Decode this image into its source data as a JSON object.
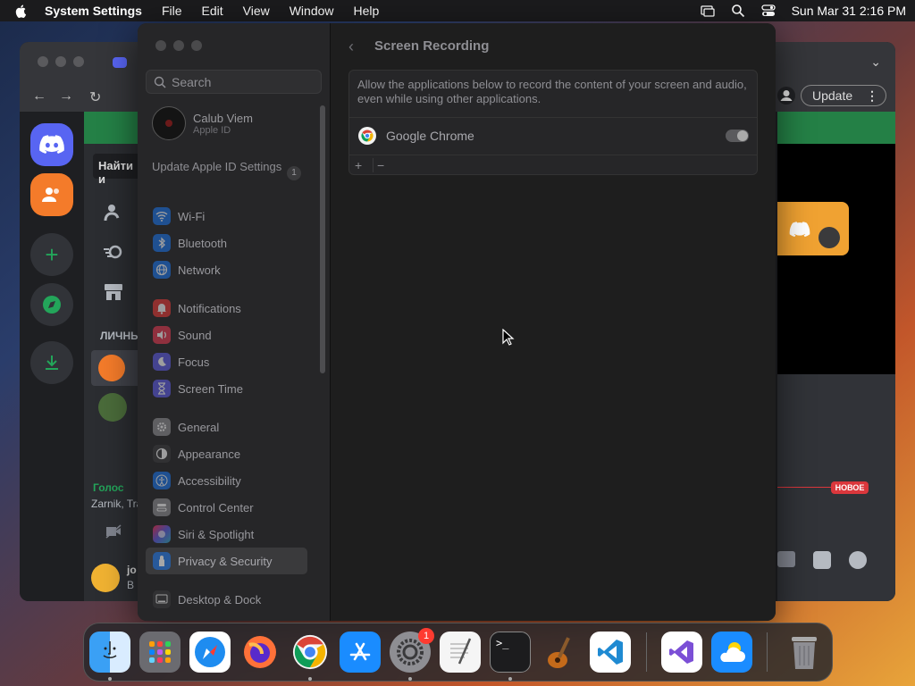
{
  "menubar": {
    "app": "System Settings",
    "items": [
      "File",
      "Edit",
      "View",
      "Window",
      "Help"
    ],
    "datetime": "Sun Mar 31  2:16 PM"
  },
  "chrome": {
    "update_label": "Update"
  },
  "discord": {
    "find_label": "Найти и",
    "section_label": "ЛИЧНЫ",
    "voice_label": "Голос",
    "voice_sub": "Zarnik, Tra",
    "user_label": "jo",
    "user_sub": "В",
    "new_badge": "НОВОЕ"
  },
  "settings": {
    "search_placeholder": "Search",
    "account": {
      "name": "Calub Viem",
      "sub": "Apple ID"
    },
    "update_apple_id": "Update Apple ID Settings",
    "update_badge": "1",
    "sidebar": [
      {
        "label": "Wi-Fi",
        "icon": "wifi-icon",
        "color": "#1a73e8"
      },
      {
        "label": "Bluetooth",
        "icon": "bluetooth-icon",
        "color": "#1a73e8"
      },
      {
        "label": "Network",
        "icon": "network-icon",
        "color": "#1a73e8"
      },
      {
        "label": "Notifications",
        "icon": "notifications-icon",
        "color": "#e53935"
      },
      {
        "label": "Sound",
        "icon": "sound-icon",
        "color": "#e53950"
      },
      {
        "label": "Focus",
        "icon": "focus-icon",
        "color": "#5e5ce6"
      },
      {
        "label": "Screen Time",
        "icon": "screen-time-icon",
        "color": "#5e5ce6"
      },
      {
        "label": "General",
        "icon": "general-icon",
        "color": "#8e8e93"
      },
      {
        "label": "Appearance",
        "icon": "appearance-icon",
        "color": "#3a3a3c"
      },
      {
        "label": "Accessibility",
        "icon": "accessibility-icon",
        "color": "#1a73e8"
      },
      {
        "label": "Control Center",
        "icon": "control-center-icon",
        "color": "#8e8e93"
      },
      {
        "label": "Siri & Spotlight",
        "icon": "siri-icon",
        "color": "#b03ad8"
      },
      {
        "label": "Privacy & Security",
        "icon": "privacy-icon",
        "color": "#1a73e8"
      },
      {
        "label": "Desktop & Dock",
        "icon": "desktop-dock-icon",
        "color": "#3a3a3c"
      }
    ],
    "page_title": "Screen Recording",
    "description": "Allow the applications below to record the content of your screen and audio, even while using other applications.",
    "apps": [
      {
        "name": "Google Chrome",
        "enabled": true
      }
    ],
    "add_label": "+",
    "remove_label": "−"
  },
  "dock": {
    "badge": "1"
  }
}
